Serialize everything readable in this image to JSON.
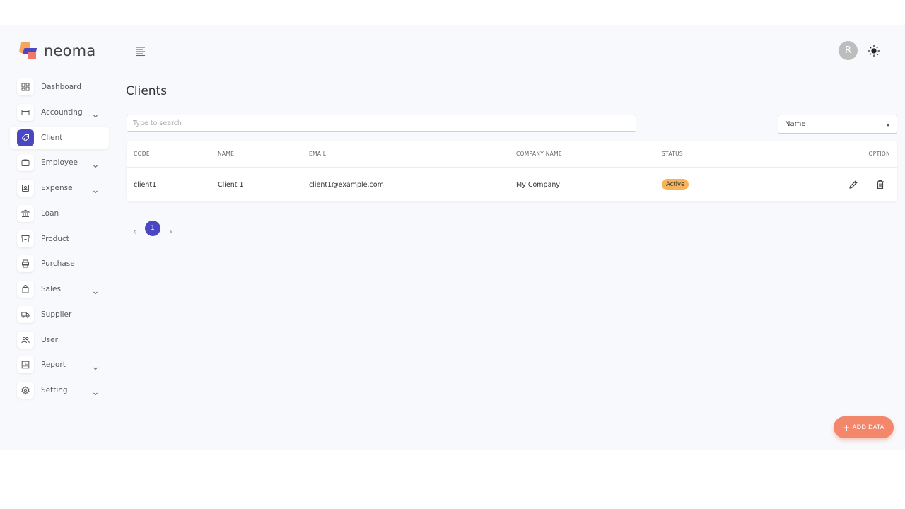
{
  "brand": {
    "name": "neoma"
  },
  "header": {
    "avatar_initial": "R"
  },
  "sidebar": {
    "items": [
      {
        "label": "Dashboard",
        "icon": "dashboard-icon",
        "has_submenu": false,
        "active": false
      },
      {
        "label": "Accounting",
        "icon": "wallet-icon",
        "has_submenu": true,
        "active": false
      },
      {
        "label": "Client",
        "icon": "tag-icon",
        "has_submenu": false,
        "active": true
      },
      {
        "label": "Employee",
        "icon": "briefcase-icon",
        "has_submenu": true,
        "active": false
      },
      {
        "label": "Expense",
        "icon": "receipt-icon",
        "has_submenu": true,
        "active": false
      },
      {
        "label": "Loan",
        "icon": "bank-icon",
        "has_submenu": false,
        "active": false
      },
      {
        "label": "Product",
        "icon": "archive-icon",
        "has_submenu": false,
        "active": false
      },
      {
        "label": "Purchase",
        "icon": "printer-icon",
        "has_submenu": false,
        "active": false
      },
      {
        "label": "Sales",
        "icon": "shopping-bag-icon",
        "has_submenu": true,
        "active": false
      },
      {
        "label": "Supplier",
        "icon": "truck-icon",
        "has_submenu": false,
        "active": false
      },
      {
        "label": "User",
        "icon": "users-icon",
        "has_submenu": false,
        "active": false
      },
      {
        "label": "Report",
        "icon": "chart-icon",
        "has_submenu": true,
        "active": false
      },
      {
        "label": "Setting",
        "icon": "gear-icon",
        "has_submenu": true,
        "active": false
      }
    ]
  },
  "main": {
    "title": "Clients",
    "search": {
      "placeholder": "Type to search ...",
      "value": ""
    },
    "sort_select": {
      "value": "Name"
    },
    "table": {
      "columns": [
        "CODE",
        "NAME",
        "EMAIL",
        "COMPANY NAME",
        "STATUS",
        "OPTION"
      ],
      "rows": [
        {
          "code": "client1",
          "name": "Client 1",
          "email": "client1@example.com",
          "company": "My Company",
          "status": "Active"
        }
      ]
    },
    "pagination": {
      "current_page": "1"
    },
    "add_button": {
      "label": "ADD DATA"
    }
  },
  "colors": {
    "accent": "#4b46c2",
    "add_button": "#f2876c",
    "status_active": "#f7b35a",
    "background": "#f8f9fc"
  }
}
